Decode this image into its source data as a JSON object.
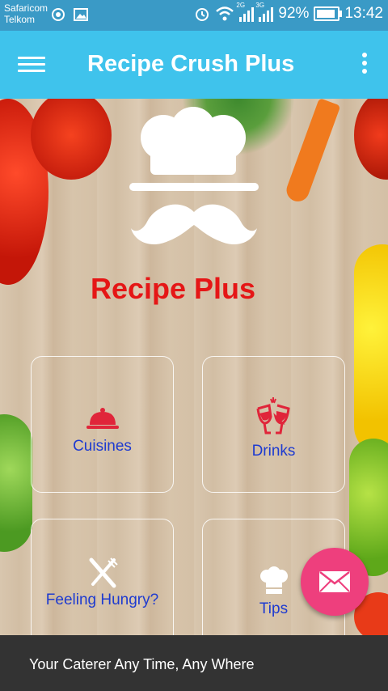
{
  "status_bar": {
    "carrier_1": "Safaricom",
    "carrier_2": "Telkom",
    "network_1": "2G",
    "network_2": "3G",
    "battery": "92%",
    "time": "13:42"
  },
  "app_bar": {
    "title": "Recipe Crush Plus",
    "menu_icon": "hamburger-menu-icon",
    "overflow_icon": "more-vertical-icon"
  },
  "hero": {
    "app_name": "Recipe Plus",
    "logo": "chef-hat-mustache-logo"
  },
  "tiles": [
    {
      "label": "Cuisines",
      "icon": "serving-cloche-icon"
    },
    {
      "label": "Drinks",
      "icon": "wine-glasses-icon"
    },
    {
      "label": "Feeling Hungry?",
      "icon": "fork-knife-icon"
    },
    {
      "label": "Tips",
      "icon": "chef-hat-icon"
    }
  ],
  "fab": {
    "icon": "mail-icon"
  },
  "footer": {
    "tagline": "Your Caterer Any Time, Any Where"
  },
  "colors": {
    "app_bar": "#3fc3ec",
    "status_bar": "#3a9ac6",
    "brand_red": "#e51616",
    "tile_text": "#1e3bd0",
    "fab": "#ee3f7d",
    "footer": "#333333"
  }
}
